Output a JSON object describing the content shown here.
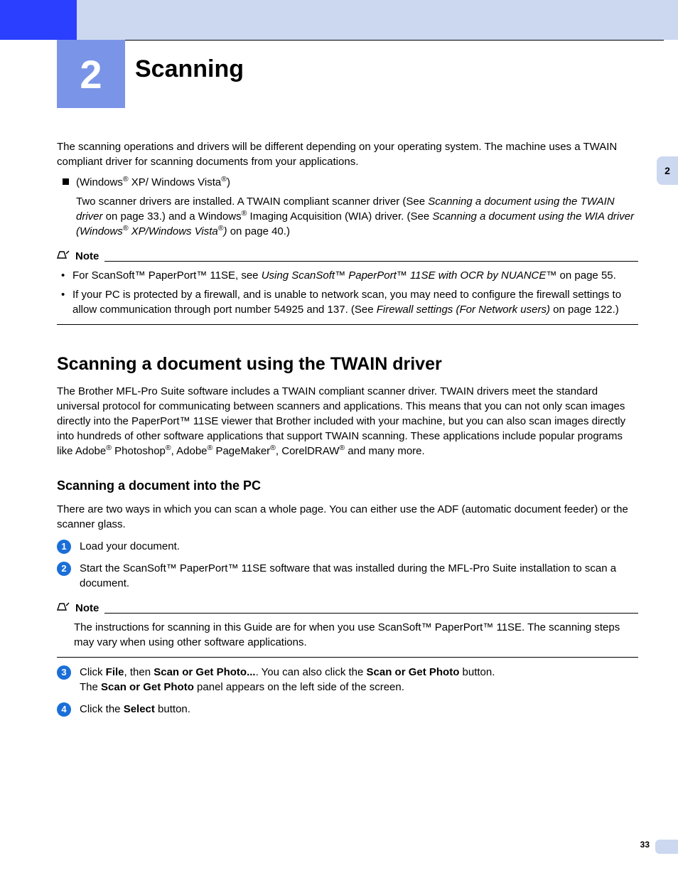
{
  "header": {
    "chapter_number": "2",
    "chapter_title": "Scanning",
    "side_tab": "2"
  },
  "intro_para": "The scanning operations and drivers will be different depending on your operating system. The machine uses a TWAIN compliant driver for scanning documents from your applications.",
  "os_item": {
    "line1_a": "(Windows",
    "line1_b": " XP/ Windows Vista",
    "line1_c": ")",
    "line2_a": "Two scanner drivers are installed. A TWAIN compliant scanner driver (See ",
    "line2_link1": "Scanning a document using the TWAIN driver",
    "line2_b": " on page 33.) and a Windows",
    "line2_c": " Imaging Acquisition (WIA) driver. (See ",
    "line2_link2": "Scanning a document using the WIA driver (Windows",
    "line2_link2_b": " XP/Windows Vista",
    "line2_link2_c": ")",
    "line2_d": " on page 40.)"
  },
  "note1": {
    "label": "Note",
    "b1_a": "For ScanSoft™ PaperPort™ 11SE, see ",
    "b1_link": "Using ScanSoft™ PaperPort™ 11SE with OCR by NUANCE™",
    "b1_b": " on page 55.",
    "b2_a": "If your PC is protected by a firewall, and is unable to network scan, you may need to configure the firewall settings to allow communication through port number 54925 and 137. (See ",
    "b2_link": "Firewall settings (For Network users)",
    "b2_b": " on page 122.)"
  },
  "section2": {
    "title": "Scanning a document using the TWAIN driver",
    "p_a": "The Brother MFL-Pro Suite software includes a TWAIN compliant scanner driver. TWAIN drivers meet the standard universal protocol for communicating between scanners and applications. This means that you can not only scan images directly into the PaperPort™ 11SE viewer that Brother included with your machine, but you can also scan images directly into hundreds of other software applications that support TWAIN scanning. These applications include popular programs like Adobe",
    "p_b": " Photoshop",
    "p_c": ", Adobe",
    "p_d": " PageMaker",
    "p_e": ", CorelDRAW",
    "p_f": " and many more."
  },
  "section3": {
    "title": "Scanning a document into the PC",
    "intro": "There are two ways in which you can scan a whole page. You can either use the ADF (automatic document feeder) or the scanner glass.",
    "step1": "Load your document.",
    "step2": "Start the ScanSoft™ PaperPort™ 11SE software that was installed during the MFL-Pro Suite installation to scan a document.",
    "step3_a": "Click ",
    "step3_b": "File",
    "step3_c": ", then ",
    "step3_d": "Scan or Get Photo...",
    "step3_e": ". You can also click the ",
    "step3_f": "Scan or Get Photo",
    "step3_g": " button.",
    "step3_h": "The ",
    "step3_i": "Scan or Get Photo",
    "step3_j": " panel appears on the left side of the screen.",
    "step4_a": "Click the ",
    "step4_b": "Select",
    "step4_c": " button."
  },
  "note2": {
    "label": "Note",
    "text": "The instructions for scanning in this Guide are for when you use ScanSoft™ PaperPort™ 11SE. The scanning steps may vary when using other software applications."
  },
  "page_number": "33"
}
